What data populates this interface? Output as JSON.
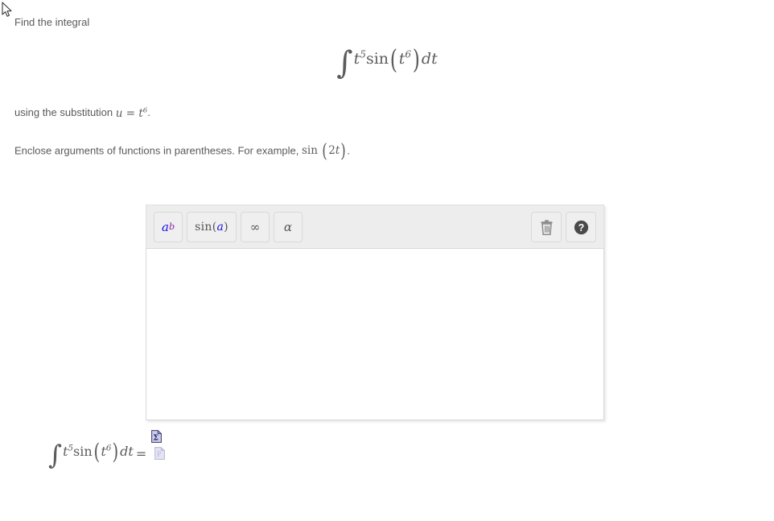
{
  "page": {
    "prompt": "Find the integral",
    "substitution_text": "using the substitution ",
    "substitution_math": "u = t^6",
    "hint_text": "Enclose arguments of functions in parentheses. For example, ",
    "hint_math": "sin (2t)",
    "display_integral": "∫ t^5 sin ( t^6 ) dt",
    "answer_prefix": "∫ t^5 sin ( t^6 ) dt",
    "equals_sign": "=",
    "cursor_icon": "arrow-cursor-icon"
  },
  "math_symbols": {
    "integral": "∫",
    "t": "t",
    "exp5": "5",
    "exp6": "6",
    "sin": "sin",
    "paren_open": "(",
    "paren_close": ")",
    "dt_d": "d",
    "dt_t": "t",
    "u": "u",
    "equals": "=",
    "two": "2",
    "period": "."
  },
  "editor": {
    "toolbar": {
      "buttons": [
        {
          "name": "exponent-button",
          "label_a": "a",
          "label_b": "b",
          "title": "exponent"
        },
        {
          "name": "sin-button",
          "label_fn": "sin",
          "label_open": "(",
          "label_arg": "a",
          "label_close": ")",
          "title": "sine function"
        },
        {
          "name": "infinity-button",
          "label": "∞",
          "title": "infinity"
        },
        {
          "name": "greek-button",
          "label": "α",
          "title": "greek letters"
        }
      ],
      "actions": [
        {
          "name": "clear-button",
          "icon": "trash-icon",
          "title": "clear"
        },
        {
          "name": "help-button",
          "icon": "help-circle-icon",
          "title": "help"
        }
      ]
    },
    "canvas": {
      "value": "",
      "placeholder": ""
    }
  },
  "answer": {
    "sigma_icon": "sigma-document-icon",
    "answer_box_icon": "answer-document-icon"
  },
  "colors": {
    "text": "#5a5a5a",
    "math": "#5c5c5c",
    "toolbar_bg": "#ededed",
    "button_bg": "#efefef",
    "button_border": "#d9d9d9",
    "canvas_border": "#d8d8d8",
    "accent_blue": "#1515e0",
    "accent_purple": "#8a1fa8",
    "icon_gray": "#8b8b8b",
    "doc_icon_fill": "#c9cbe8"
  }
}
